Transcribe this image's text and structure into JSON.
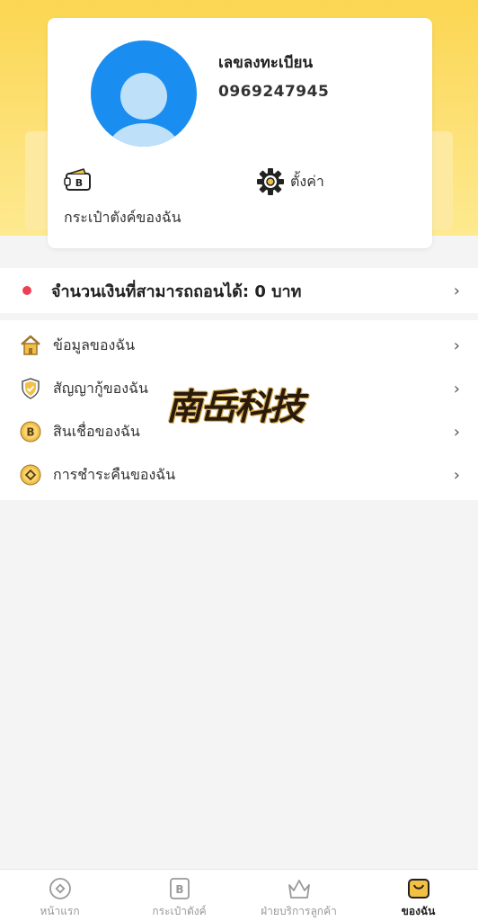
{
  "profile": {
    "registration_label": "เลขลงทะเบียน",
    "phone": "0969247945",
    "wallet_label": "กระเป๋าตังค์ของฉัน",
    "settings_label": "ตั้งค่า"
  },
  "withdraw": {
    "text": "จำนวนเงินที่สามารถถอนได้: 0 บาท"
  },
  "menu": {
    "items": [
      {
        "label": "ข้อมูลของฉัน",
        "icon": "home-icon"
      },
      {
        "label": "สัญญากู้ของฉัน",
        "icon": "shield-check-icon"
      },
      {
        "label": "สินเชื่อของฉัน",
        "icon": "coin-b-icon"
      },
      {
        "label": "การชำระคืนของฉัน",
        "icon": "coin-diamond-icon"
      }
    ]
  },
  "watermark": "南岳科技",
  "tabbar": {
    "items": [
      {
        "label": "หน้าแรก",
        "icon": "home-circle-icon",
        "active": false
      },
      {
        "label": "กระเป๋าตังค์",
        "icon": "wallet-b-icon",
        "active": false
      },
      {
        "label": "ฝ่ายบริการลูกค้า",
        "icon": "crown-icon",
        "active": false
      },
      {
        "label": "ของฉัน",
        "icon": "profile-card-icon",
        "active": true
      }
    ]
  },
  "colors": {
    "hero": "#fbd652",
    "accent_blue": "#1a8ef0",
    "dot_red": "#ee4055",
    "icon_gold": "#e8b23a"
  }
}
